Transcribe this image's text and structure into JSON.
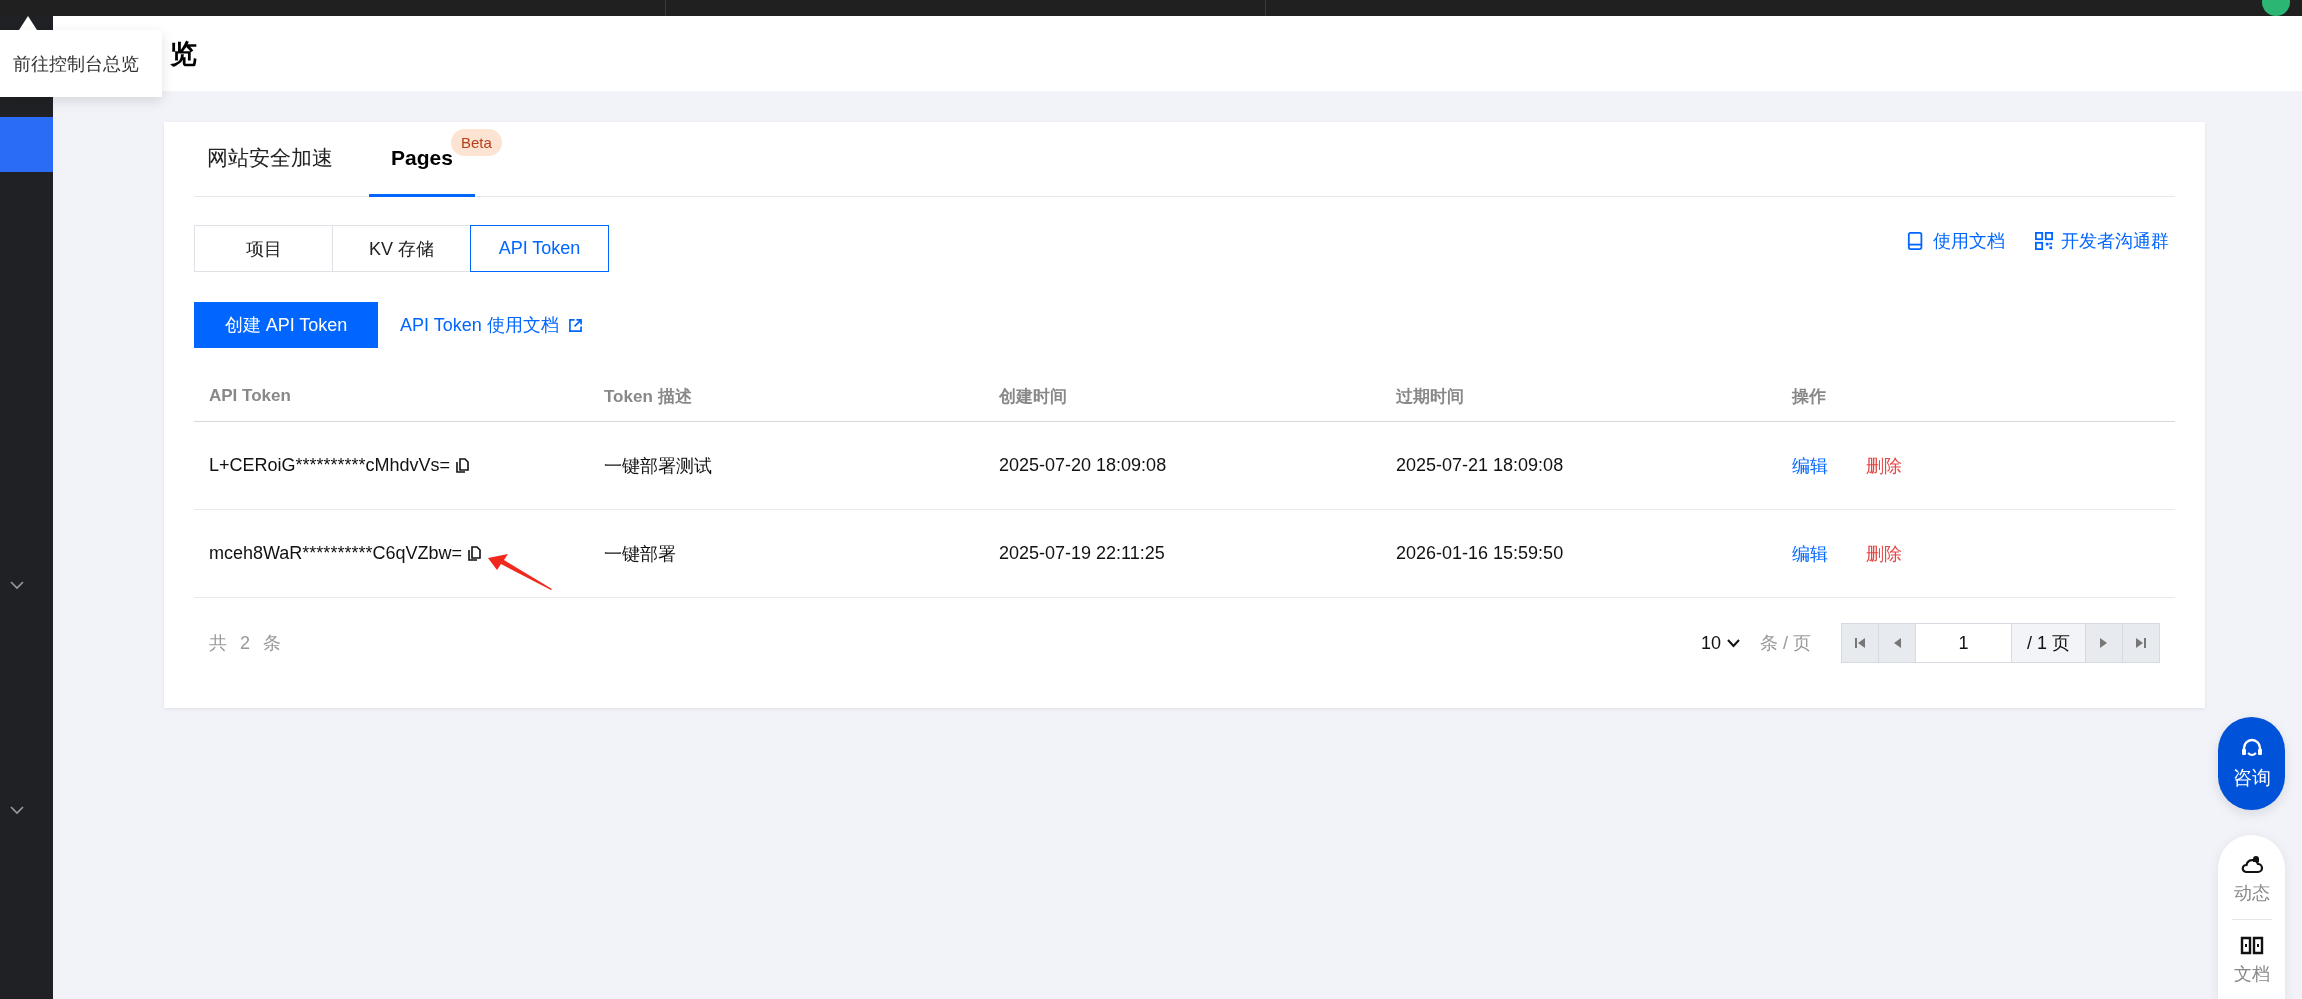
{
  "sidebar": {
    "items": [
      {
        "kind": "entry",
        "selected": true
      },
      {
        "kind": "group",
        "selected": false
      },
      {
        "kind": "group",
        "selected": false
      }
    ]
  },
  "tooltip": {
    "text": "前往控制台总览"
  },
  "header": {
    "title": "览"
  },
  "tabs": [
    {
      "label": "网站安全加速",
      "selected": false
    },
    {
      "label": "Pages",
      "selected": true,
      "badge": "Beta"
    }
  ],
  "segments": [
    {
      "label": "项目",
      "selected": false
    },
    {
      "label": "KV 存储",
      "selected": false
    },
    {
      "label": "API Token",
      "selected": true
    }
  ],
  "header_links": [
    {
      "label": "使用文档",
      "kind": "book"
    },
    {
      "label": "开发者沟通群",
      "kind": "qr"
    }
  ],
  "create_button": "创建 API Token",
  "doc_link": "API Token 使用文档",
  "table": {
    "columns": [
      "API Token",
      "Token 描述",
      "创建时间",
      "过期时间",
      "操作"
    ],
    "rows": [
      {
        "token": "L+CERoiG**********cMhdvVs=",
        "description": "一键部署测试",
        "created": "2025-07-20 18:09:08",
        "expires": "2025-07-21 18:09:08",
        "annotated": false,
        "actions": [
          {
            "label": "编辑",
            "kind": "edit"
          },
          {
            "label": "删除",
            "kind": "danger"
          }
        ]
      },
      {
        "token": "mceh8WaR**********C6qVZbw=",
        "description": "一键部署",
        "created": "2025-07-19 22:11:25",
        "expires": "2026-01-16 15:59:50",
        "annotated": true,
        "actions": [
          {
            "label": "编辑",
            "kind": "edit"
          },
          {
            "label": "删除",
            "kind": "danger"
          }
        ]
      }
    ]
  },
  "total": "共 2 条",
  "pagination": {
    "page_size": "10",
    "page_size_unit": "条 / 页",
    "page": "1",
    "page_total": "/ 1 页"
  },
  "float_tools": {
    "consult": "咨询",
    "items": [
      {
        "label": "动态",
        "kind": "cloud"
      },
      {
        "label": "文档",
        "kind": "book"
      }
    ]
  }
}
